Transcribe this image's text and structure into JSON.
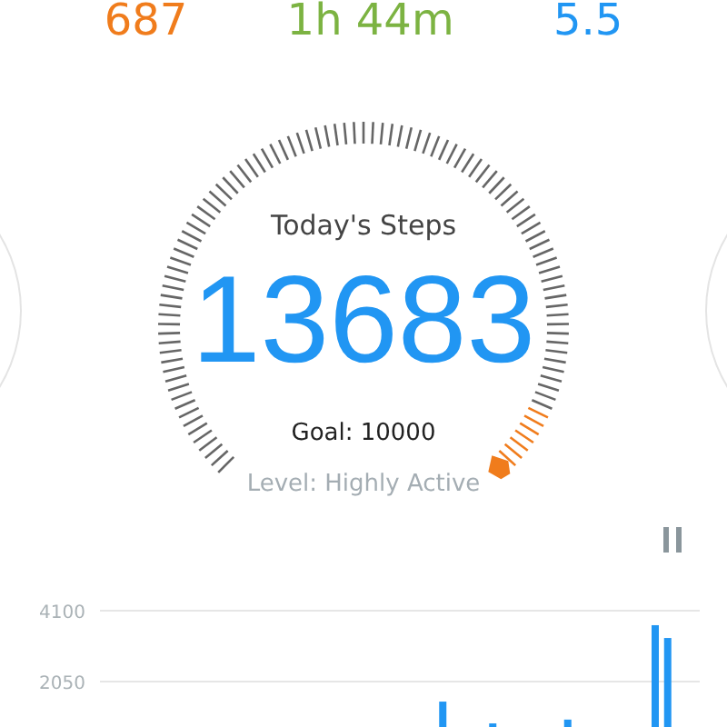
{
  "stats": [
    {
      "value": "687",
      "color": "#f07c1c"
    },
    {
      "value": "1h 44m",
      "color": "#7cb342"
    },
    {
      "value": "5.5",
      "color": "#2196f3"
    }
  ],
  "dial": {
    "title": "Today's Steps",
    "steps": "13683",
    "goal": "Goal: 10000",
    "activity_level": "Level: Highly Active"
  },
  "chart": {
    "chart_data": {
      "type": "bar",
      "yticks": [
        2050,
        4100
      ],
      "ylim": [
        0,
        4100
      ],
      "values": [
        0,
        0,
        0,
        0,
        0,
        0,
        0,
        0,
        0,
        0,
        0,
        0,
        0,
        0,
        0,
        0,
        0,
        0,
        0,
        0,
        0,
        0,
        0,
        0,
        0,
        0,
        0,
        1470,
        0,
        0,
        0,
        840,
        0,
        0,
        0,
        0,
        0,
        950,
        0,
        0,
        0,
        0,
        0,
        0,
        3680,
        3310,
        0,
        0
      ]
    }
  }
}
